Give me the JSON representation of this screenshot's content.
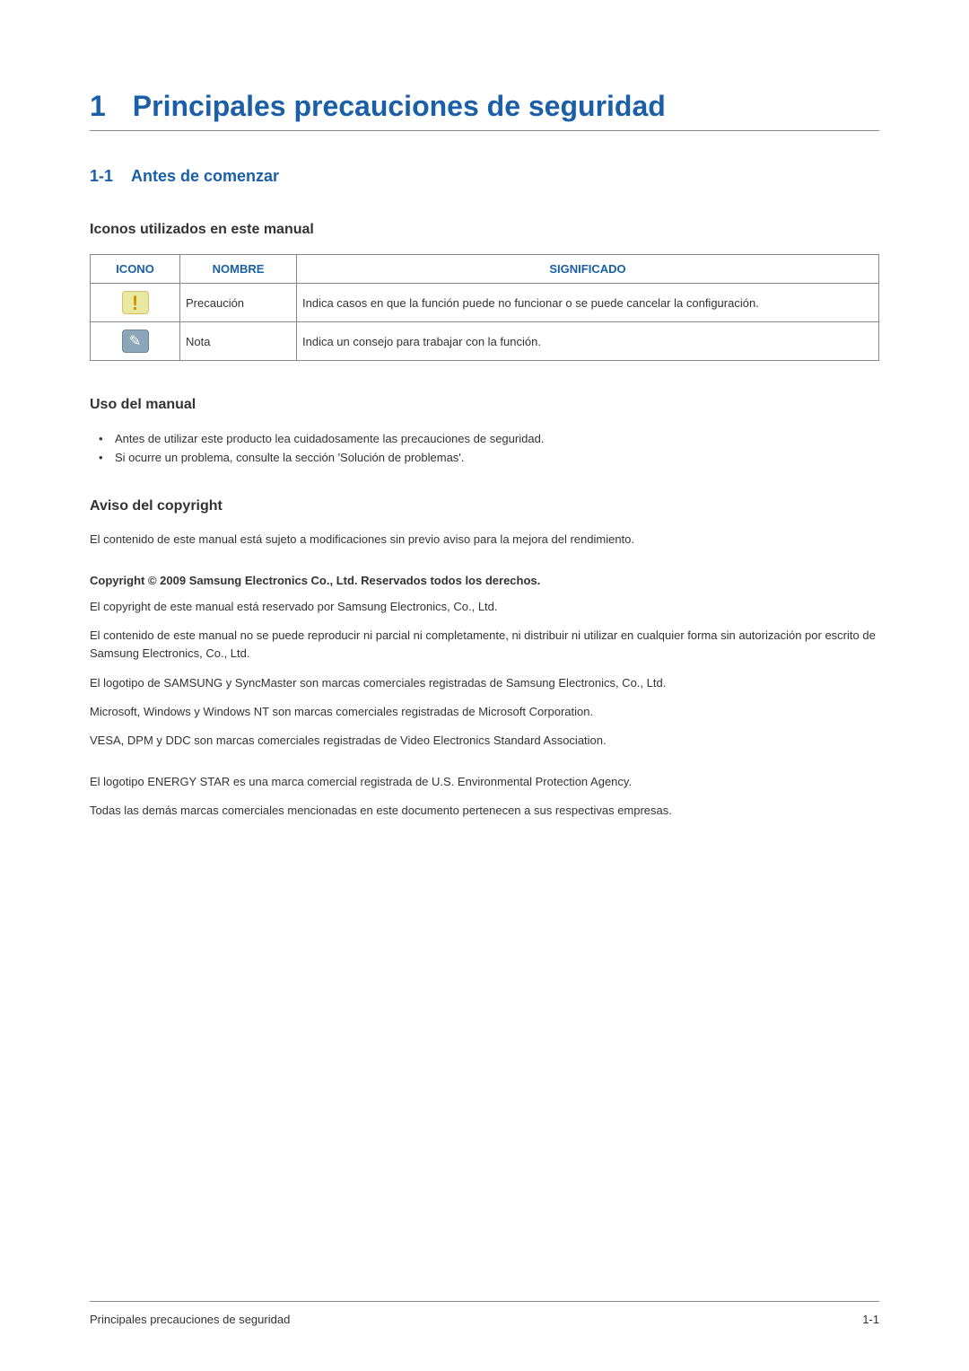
{
  "chapter": {
    "number": "1",
    "title": "Principales precauciones de seguridad"
  },
  "section": {
    "number": "1-1",
    "title": "Antes de comenzar"
  },
  "icons_section": {
    "heading": "Iconos utilizados en este manual",
    "headers": {
      "icon": "ICONO",
      "name": "NOMBRE",
      "meaning": "SIGNIFICADO"
    },
    "rows": [
      {
        "name": "Precaución",
        "meaning": "Indica casos en que la función puede no funcionar o se puede cancelar la configuración."
      },
      {
        "name": "Nota",
        "meaning": "Indica un consejo para trabajar con la función."
      }
    ]
  },
  "usage": {
    "heading": "Uso del manual",
    "items": [
      "Antes de utilizar este producto lea cuidadosamente las precauciones de seguridad.",
      "Si ocurre un problema, consulte la sección 'Solución de problemas'."
    ]
  },
  "copyright_section": {
    "heading": "Aviso del copyright",
    "intro": "El contenido de este manual está sujeto a modificaciones sin previo aviso para la mejora del rendimiento.",
    "copyright_line": "Copyright © 2009 Samsung Electronics Co., Ltd. Reservados todos los derechos.",
    "paragraphs": [
      "El copyright de este manual está reservado por Samsung Electronics, Co., Ltd.",
      "El contenido de este manual no se puede reproducir ni parcial ni completamente, ni distribuir ni utilizar en cualquier forma sin autorización por escrito de Samsung Electronics, Co., Ltd.",
      "El logotipo de SAMSUNG y SyncMaster son marcas comerciales registradas de Samsung Electronics, Co., Ltd.",
      "Microsoft, Windows y Windows NT son marcas comerciales registradas de Microsoft Corporation.",
      "VESA, DPM y DDC son marcas comerciales registradas de Video Electronics Standard Association."
    ],
    "paragraphs2": [
      "El logotipo ENERGY STAR es una marca comercial registrada de U.S. Environmental Protection Agency.",
      "Todas las demás marcas comerciales mencionadas en este documento pertenecen a sus respectivas empresas."
    ]
  },
  "footer": {
    "left": "Principales precauciones de seguridad",
    "right": "1-1"
  }
}
